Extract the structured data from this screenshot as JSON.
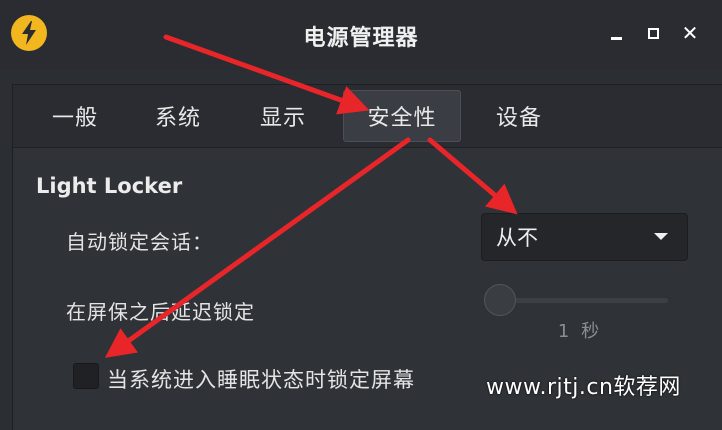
{
  "window": {
    "title": "电源管理器",
    "icon": "lightning-bolt-icon",
    "accent_color": "#f2b71f",
    "minimize_icon": "minimize-icon",
    "maximize_icon": "maximize-icon",
    "close_icon": "close-icon",
    "close_label": "✕"
  },
  "tabs": [
    {
      "label": "一般",
      "active": false
    },
    {
      "label": "系统",
      "active": false
    },
    {
      "label": "显示",
      "active": false
    },
    {
      "label": "安全性",
      "active": true
    },
    {
      "label": "设备",
      "active": false
    }
  ],
  "security": {
    "section_title": "Light Locker",
    "auto_lock_label": "自动锁定会话：",
    "auto_lock_value": "从不",
    "delay_label": "在屏保之后延迟锁定",
    "delay_slider_level": 0,
    "delay_value_text": "1 秒",
    "lock_on_sleep_label": "当系统进入睡眠状态时锁定屏幕",
    "lock_on_sleep_checked": false
  },
  "annotation": {
    "arrow_color": "#e8262a"
  },
  "watermark": {
    "text": "www.rjtj.cn软荐网"
  }
}
